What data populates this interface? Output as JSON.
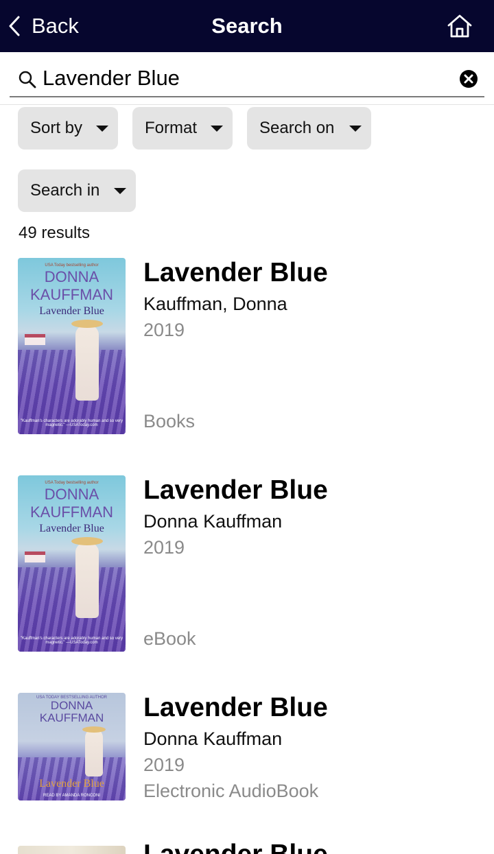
{
  "nav": {
    "back_label": "Back",
    "title": "Search",
    "home_icon": "home-icon"
  },
  "search": {
    "value": "Lavender Blue",
    "placeholder": "",
    "search_icon": "search-icon",
    "clear_icon": "clear-circle-icon"
  },
  "filters": [
    {
      "label": "Sort by"
    },
    {
      "label": "Format"
    },
    {
      "label": "Search on"
    },
    {
      "label": "Search in"
    }
  ],
  "results_count": "49 results",
  "results": [
    {
      "title": "Lavender Blue",
      "author": "Kauffman, Donna",
      "year": "2019",
      "format": "Books",
      "cover": {
        "tagline": "USA Today bestselling author",
        "author_line1": "DONNA",
        "author_line2": "KAUFFMAN",
        "title": "Lavender Blue",
        "quote": "\"Kauffman's characters are adorably human and so very magnetic.\" —USAToday.com"
      }
    },
    {
      "title": "Lavender Blue",
      "author": "Donna Kauffman",
      "year": "2019",
      "format": "eBook",
      "cover": {
        "tagline": "USA Today bestselling author",
        "author_line1": "DONNA",
        "author_line2": "KAUFFMAN",
        "title": "Lavender Blue",
        "quote": "\"Kauffman's characters are adorably human and so very magnetic.\" —USAToday.com"
      }
    },
    {
      "title": "Lavender Blue",
      "author": "Donna Kauffman",
      "year": "2019",
      "format": "Electronic AudioBook",
      "cover": {
        "tagline": "USA TODAY BESTSELLING AUTHOR",
        "author_line1": "DONNA",
        "author_line2": "KAUFFMAN",
        "title": "Lavender Blue",
        "quote": "READ BY AMANDA RONCONI"
      }
    },
    {
      "title": "Lavender Blue"
    }
  ],
  "colors": {
    "navbar": "#06062e",
    "chip_bg": "#e4e4e4",
    "secondary_text": "#8a8a8a"
  }
}
